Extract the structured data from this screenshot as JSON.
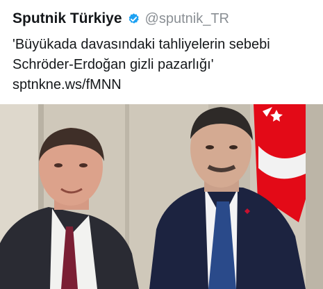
{
  "tweet": {
    "display_name": "Sputnik Türkiye",
    "handle": "@sputnik_TR",
    "verified_icon": "verified-badge-icon",
    "text_line1": "'Büyükada davasındaki tahliyelerin sebebi",
    "text_line2": "Schröder-Erdoğan gizli pazarlığı'",
    "link": "sptnkne.ws/fMNN"
  },
  "photo": {
    "description_icon": "photo-two-men-icon"
  },
  "colors": {
    "verified": "#1da1f2",
    "handle": "#8a8f94",
    "flag": "#e30a17"
  }
}
